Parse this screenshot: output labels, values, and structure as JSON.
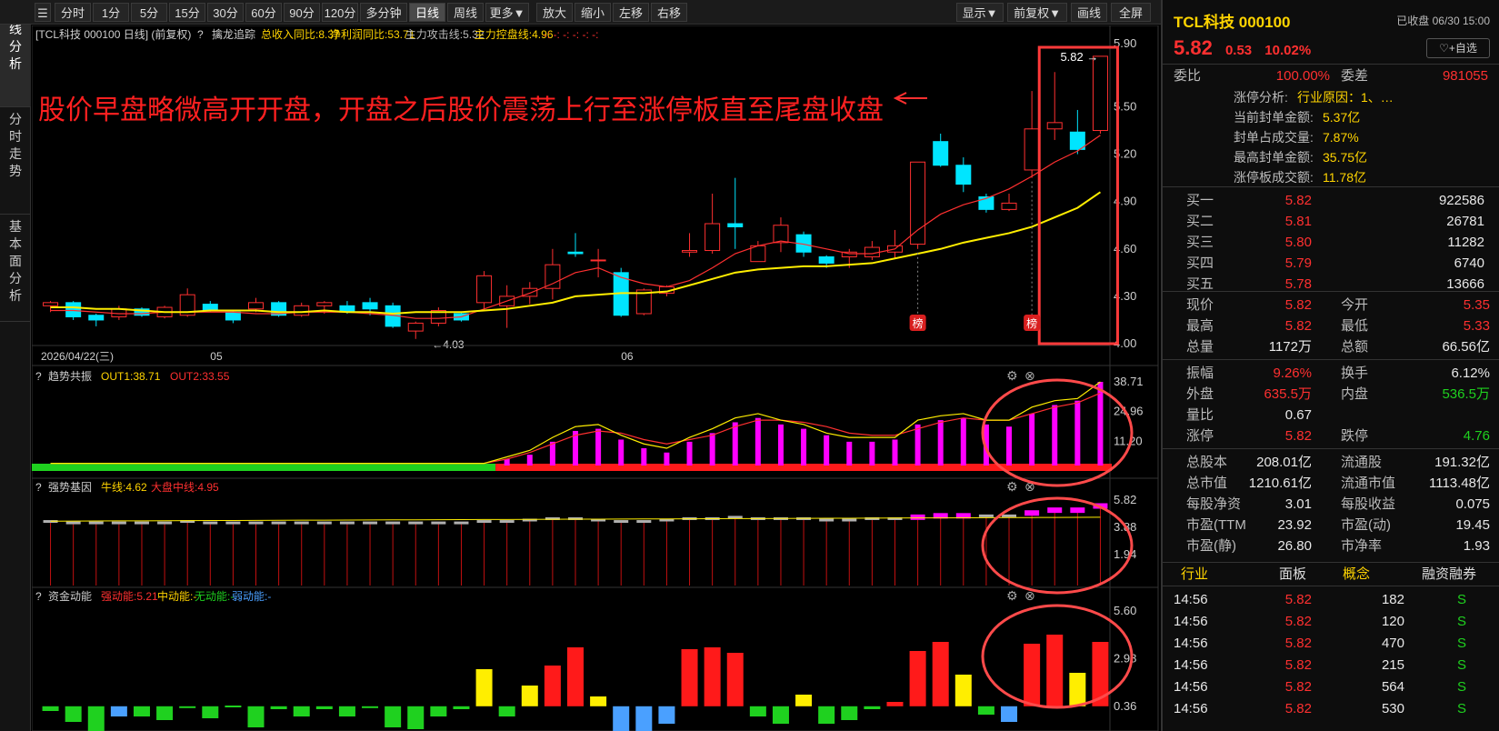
{
  "toolbar": {
    "periods": [
      "分时",
      "1分",
      "5分",
      "15分",
      "30分",
      "60分",
      "90分",
      "120分",
      "多分钟",
      "日线",
      "周线",
      "更多▼"
    ],
    "active": "日线",
    "actions": [
      "放大",
      "缩小",
      "左移",
      "右移"
    ],
    "right": [
      "显示▼",
      "前复权▼",
      "画线",
      "全屏"
    ]
  },
  "left_tabs": [
    "K线分析",
    "分时走势",
    "基本面分析"
  ],
  "main": {
    "title": "[TCL科技 000100 日线]",
    "adj": "(前复权)",
    "indicator_name": "擒龙追踪",
    "ind_items": [
      {
        "text": "总收入同比:8.37",
        "color": "#ffd400"
      },
      {
        "text": "净利润同比:53.71",
        "color": "#ffd400"
      },
      {
        "text": "主力攻击线:5.32",
        "color": "#bbbbbb"
      },
      {
        "text": "主力控盘线:4.96",
        "color": "#ffd400"
      },
      {
        "text": "-:  -:  -:  -:  -:  -:",
        "color": "#ff3030"
      }
    ],
    "annotation": "股价早盘略微高开开盘，开盘之后股价震荡上行至涨停板直至尾盘收盘",
    "high_label": "5.82",
    "low_label": "4.03",
    "bang": "榜",
    "date_label": "2026/04/22(三)",
    "month_labels": [
      "05",
      "06"
    ],
    "y_ticks": [
      "5.90",
      "5.50",
      "5.20",
      "4.90",
      "4.60",
      "4.30",
      "4.00"
    ]
  },
  "sub1": {
    "name": "趋势共振",
    "items": [
      {
        "text": "OUT1:38.71",
        "color": "#ffd400"
      },
      {
        "text": "OUT2:33.55",
        "color": "#ff3030"
      }
    ],
    "y_ticks": [
      "38.71",
      "24.96",
      "11.20"
    ]
  },
  "sub2": {
    "name": "强势基因",
    "items": [
      {
        "text": "牛线:4.62",
        "color": "#ffd400"
      },
      {
        "text": "大盘中线:4.95",
        "color": "#ff3030"
      }
    ],
    "y_ticks": [
      "5.82",
      "3.88",
      "1.94"
    ]
  },
  "sub3": {
    "name": "资金动能",
    "items": [
      {
        "text": "强动能:5.21",
        "color": "#ff3030"
      },
      {
        "text": "中动能:-",
        "color": "#ffd400"
      },
      {
        "text": "无动能:-",
        "color": "#1fd11f"
      },
      {
        "text": "弱动能:-",
        "color": "#4aa0ff"
      }
    ],
    "y_ticks": [
      "5.60",
      "2.98",
      "0.36"
    ]
  },
  "chart_data": [
    {
      "type": "candlestick",
      "title": "TCL科技 000100 日线",
      "ylim": [
        4.0,
        5.9
      ],
      "candles": [
        [
          4.24,
          4.26,
          4.2,
          4.27
        ],
        [
          4.26,
          4.17,
          4.15,
          4.27
        ],
        [
          4.18,
          4.15,
          4.11,
          4.19
        ],
        [
          4.17,
          4.22,
          4.15,
          4.24
        ],
        [
          4.22,
          4.18,
          4.17,
          4.23
        ],
        [
          4.17,
          4.23,
          4.16,
          4.24
        ],
        [
          4.18,
          4.31,
          4.17,
          4.35
        ],
        [
          4.25,
          4.21,
          4.2,
          4.27
        ],
        [
          4.2,
          4.15,
          4.13,
          4.21
        ],
        [
          4.22,
          4.26,
          4.2,
          4.29
        ],
        [
          4.26,
          4.18,
          4.17,
          4.27
        ],
        [
          4.18,
          4.24,
          4.17,
          4.26
        ],
        [
          4.24,
          4.26,
          4.19,
          4.27
        ],
        [
          4.24,
          4.2,
          4.19,
          4.27
        ],
        [
          4.26,
          4.22,
          4.18,
          4.29
        ],
        [
          4.24,
          4.11,
          4.1,
          4.26
        ],
        [
          4.08,
          4.13,
          4.03,
          4.14
        ],
        [
          4.13,
          4.21,
          4.11,
          4.23
        ],
        [
          4.19,
          4.15,
          4.14,
          4.2
        ],
        [
          4.26,
          4.43,
          4.22,
          4.46
        ],
        [
          4.24,
          4.3,
          4.1,
          4.37
        ],
        [
          4.3,
          4.35,
          4.25,
          4.39
        ],
        [
          4.35,
          4.5,
          4.28,
          4.6
        ],
        [
          4.58,
          4.57,
          4.55,
          4.7
        ],
        [
          4.53,
          4.53,
          4.42,
          4.6
        ],
        [
          4.45,
          4.18,
          4.17,
          4.48
        ],
        [
          4.19,
          4.34,
          4.18,
          4.35
        ],
        [
          4.32,
          4.36,
          4.3,
          4.37
        ],
        [
          4.58,
          4.59,
          4.55,
          4.7
        ],
        [
          4.59,
          4.76,
          4.57,
          4.95
        ],
        [
          4.76,
          4.74,
          4.6,
          5.05
        ],
        [
          4.52,
          4.62,
          4.54,
          4.65
        ],
        [
          4.64,
          4.75,
          4.58,
          4.8
        ],
        [
          4.69,
          4.58,
          4.55,
          4.71
        ],
        [
          4.55,
          4.51,
          4.48,
          4.56
        ],
        [
          4.55,
          4.58,
          4.48,
          4.6
        ],
        [
          4.55,
          4.61,
          4.53,
          4.65
        ],
        [
          4.58,
          4.62,
          4.54,
          4.72
        ],
        [
          4.63,
          5.15,
          4.6,
          5.15
        ],
        [
          5.28,
          5.13,
          5.12,
          5.33
        ],
        [
          5.13,
          5.01,
          4.96,
          5.18
        ],
        [
          4.93,
          4.85,
          4.83,
          4.95
        ],
        [
          4.85,
          4.89,
          4.84,
          4.95
        ],
        [
          5.1,
          5.36,
          5.05,
          5.6
        ],
        [
          5.36,
          5.4,
          5.29,
          5.72
        ],
        [
          5.34,
          5.23,
          5.2,
          5.48
        ],
        [
          5.35,
          5.82,
          5.33,
          5.82
        ]
      ],
      "ma_yellow": [
        4.23,
        4.23,
        4.22,
        4.22,
        4.21,
        4.2,
        4.2,
        4.21,
        4.21,
        4.21,
        4.2,
        4.2,
        4.21,
        4.2,
        4.2,
        4.19,
        4.2,
        4.2,
        4.2,
        4.21,
        4.22,
        4.24,
        4.26,
        4.3,
        4.31,
        4.32,
        4.32,
        4.33,
        4.37,
        4.41,
        4.45,
        4.47,
        4.48,
        4.49,
        4.49,
        4.5,
        4.51,
        4.54,
        4.57,
        4.6,
        4.64,
        4.67,
        4.7,
        4.74,
        4.8,
        4.86,
        4.96
      ],
      "ma_red": [
        4.21,
        4.21,
        4.2,
        4.19,
        4.19,
        4.2,
        4.2,
        4.2,
        4.2,
        4.19,
        4.19,
        4.2,
        4.2,
        4.2,
        4.19,
        4.18,
        4.16,
        4.16,
        4.17,
        4.22,
        4.27,
        4.32,
        4.38,
        4.45,
        4.48,
        4.42,
        4.38,
        4.36,
        4.4,
        4.48,
        4.57,
        4.62,
        4.65,
        4.63,
        4.6,
        4.57,
        4.57,
        4.6,
        4.72,
        4.82,
        4.88,
        4.92,
        4.98,
        5.06,
        5.15,
        5.22,
        5.32
      ]
    },
    {
      "type": "bar",
      "title": "趋势共振",
      "ylim": [
        0,
        38.71
      ],
      "values": [
        0,
        0,
        0,
        0,
        0,
        0,
        0,
        0,
        0,
        0,
        0,
        0,
        0,
        0,
        0,
        0,
        0,
        0,
        0,
        0,
        3,
        5,
        11,
        16,
        17,
        12,
        8,
        6,
        11,
        15,
        20,
        22,
        19,
        17,
        14,
        11,
        11,
        12,
        19,
        21,
        22,
        19,
        18,
        24,
        28,
        30,
        38.71
      ],
      "out1": [
        1,
        1,
        1,
        1,
        1,
        1,
        1,
        1,
        1,
        1,
        1,
        1,
        1,
        1,
        1,
        1,
        1,
        1,
        1,
        1,
        4,
        7,
        13,
        18,
        19,
        14,
        10,
        8,
        13,
        17,
        22,
        24,
        21,
        19,
        15,
        13,
        13,
        13,
        21,
        23,
        24,
        21,
        21,
        27,
        30,
        31,
        38.71
      ],
      "out2": [
        1,
        1,
        1,
        1,
        1,
        1,
        1,
        1,
        1,
        1,
        1,
        1,
        1,
        1,
        1,
        1,
        1,
        1,
        1,
        1,
        3,
        6,
        10,
        14,
        16,
        15,
        12,
        10,
        12,
        14,
        18,
        21,
        21,
        20,
        18,
        15,
        14,
        14,
        17,
        20,
        22,
        21,
        21,
        24,
        27,
        29,
        33.55
      ]
    },
    {
      "type": "bar",
      "title": "强势基因",
      "ylim": [
        0,
        5.82
      ],
      "values": [
        4.2,
        4.1,
        4.1,
        4.1,
        4.1,
        4.1,
        4.2,
        4.1,
        4.1,
        4.1,
        4.1,
        4.1,
        4.1,
        4.1,
        4.1,
        4.1,
        4.1,
        4.1,
        4.1,
        4.2,
        4.2,
        4.3,
        4.4,
        4.4,
        4.3,
        4.2,
        4.2,
        4.3,
        4.4,
        4.4,
        4.5,
        4.4,
        4.4,
        4.4,
        4.3,
        4.3,
        4.4,
        4.4,
        4.6,
        4.7,
        4.7,
        4.6,
        4.6,
        4.9,
        5.1,
        5.1,
        5.4
      ],
      "bull_line": 4.62,
      "market_mid": 4.95
    },
    {
      "type": "bar",
      "title": "资金动能",
      "ylim": [
        -0.9,
        5.6
      ],
      "values": [
        0.1,
        -0.5,
        -1.0,
        -0.2,
        -0.2,
        -0.4,
        0.3,
        -0.3,
        0.4,
        -0.8,
        0.2,
        -0.2,
        0.2,
        -0.2,
        0.3,
        -0.8,
        -0.9,
        -0.2,
        0.2,
        2.4,
        -0.2,
        1.5,
        2.6,
        3.6,
        0.9,
        -1.5,
        -1.2,
        -0.6,
        3.5,
        3.6,
        3.3,
        -0.2,
        -0.6,
        1.0,
        -0.6,
        -0.4,
        0.2,
        0.6,
        3.4,
        3.9,
        2.1,
        -0.1,
        -0.5,
        3.8,
        4.3,
        2.2,
        3.9
      ]
    }
  ],
  "quote": {
    "name": "TCL科技 000100",
    "status": "已收盘 06/30 15:00",
    "price": "5.82",
    "chg": "0.53",
    "pct": "10.02%",
    "add_btn": "♡+自选",
    "weibi_label": "委比",
    "weibi": "100.00%",
    "weicha_label": "委差",
    "weicha": "981055",
    "limit_rows": [
      {
        "label": "涨停分析:",
        "value": "行业原因：1、…",
        "vcolor": "#ffd400"
      },
      {
        "label": "当前封单金额:",
        "value": "5.37亿",
        "vcolor": "#ffd400"
      },
      {
        "label": "封单占成交量:",
        "value": "7.87%",
        "vcolor": "#ffd400"
      },
      {
        "label": "最高封单金额:",
        "value": "35.75亿",
        "vcolor": "#ffd400"
      },
      {
        "label": "涨停板成交额:",
        "value": "11.78亿",
        "vcolor": "#ffd400"
      }
    ],
    "bids": [
      {
        "label": "买一",
        "price": "5.82",
        "vol": "922586"
      },
      {
        "label": "买二",
        "price": "5.81",
        "vol": "26781"
      },
      {
        "label": "买三",
        "price": "5.80",
        "vol": "11282"
      },
      {
        "label": "买四",
        "price": "5.79",
        "vol": "6740"
      },
      {
        "label": "买五",
        "price": "5.78",
        "vol": "13666"
      }
    ],
    "stats": [
      {
        "l1": "现价",
        "v1": "5.82",
        "c1": "#ff3030",
        "l2": "今开",
        "v2": "5.35",
        "c2": "#ff3030"
      },
      {
        "l1": "最高",
        "v1": "5.82",
        "c1": "#ff3030",
        "l2": "最低",
        "v2": "5.33",
        "c2": "#ff3030"
      },
      {
        "l1": "总量",
        "v1": "1172万",
        "c1": "#e8e8e8",
        "l2": "总额",
        "v2": "66.56亿",
        "c2": "#e8e8e8"
      },
      {
        "l1": "振幅",
        "v1": "9.26%",
        "c1": "#ff3030",
        "l2": "换手",
        "v2": "6.12%",
        "c2": "#e8e8e8"
      },
      {
        "l1": "外盘",
        "v1": "635.5万",
        "c1": "#ff3030",
        "l2": "内盘",
        "v2": "536.5万",
        "c2": "#1fd11f"
      },
      {
        "l1": "量比",
        "v1": "0.67",
        "c1": "#e8e8e8",
        "l2": "",
        "v2": "",
        "c2": "#e8e8e8"
      },
      {
        "l1": "涨停",
        "v1": "5.82",
        "c1": "#ff3030",
        "l2": "跌停",
        "v2": "4.76",
        "c2": "#1fd11f"
      },
      {
        "l1": "总股本",
        "v1": "208.01亿",
        "c1": "#e8e8e8",
        "l2": "流通股",
        "v2": "191.32亿",
        "c2": "#e8e8e8"
      },
      {
        "l1": "总市值",
        "v1": "1210.61亿",
        "c1": "#e8e8e8",
        "l2": "流通市值",
        "v2": "1113.48亿",
        "c2": "#e8e8e8"
      },
      {
        "l1": "每股净资",
        "v1": "3.01",
        "c1": "#e8e8e8",
        "l2": "每股收益",
        "v2": "0.075",
        "c2": "#e8e8e8"
      },
      {
        "l1": "市盈(TTM",
        "v1": "23.92",
        "c1": "#e8e8e8",
        "l2": "市盈(动)",
        "v2": "19.45",
        "c2": "#e8e8e8"
      },
      {
        "l1": "市盈(静)",
        "v1": "26.80",
        "c1": "#e8e8e8",
        "l2": "市净率",
        "v2": "1.93",
        "c2": "#e8e8e8"
      }
    ],
    "tabs": [
      "行业",
      "面板",
      "概念",
      "融资融券"
    ],
    "trades": [
      {
        "time": "14:56",
        "price": "5.82",
        "vol": "182",
        "dir": "S"
      },
      {
        "time": "14:56",
        "price": "5.82",
        "vol": "120",
        "dir": "S"
      },
      {
        "time": "14:56",
        "price": "5.82",
        "vol": "470",
        "dir": "S"
      },
      {
        "time": "14:56",
        "price": "5.82",
        "vol": "215",
        "dir": "S"
      },
      {
        "time": "14:56",
        "price": "5.82",
        "vol": "564",
        "dir": "S"
      },
      {
        "time": "14:56",
        "price": "5.82",
        "vol": "530",
        "dir": "S"
      }
    ]
  }
}
